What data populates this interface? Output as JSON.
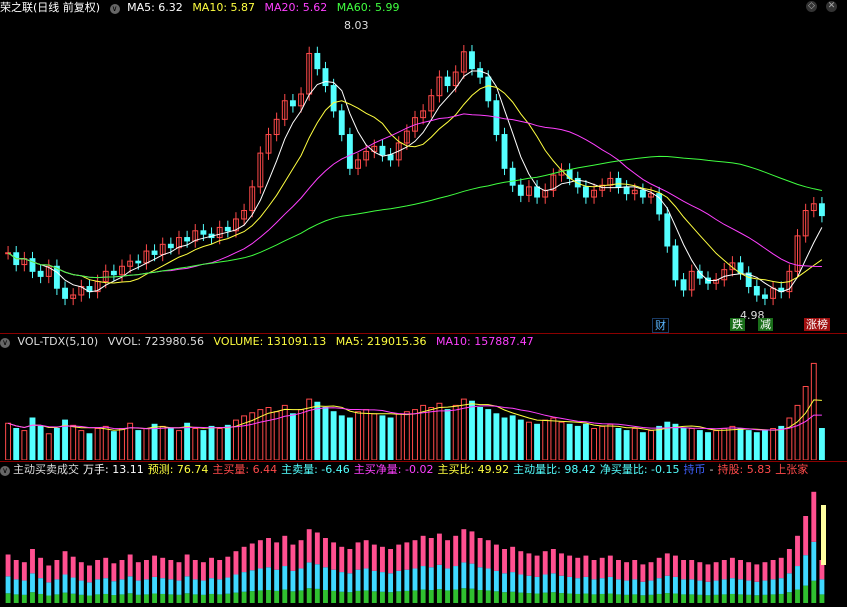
{
  "main_header": {
    "stock_name": "荣之联",
    "period": "(日线 前复权)",
    "ma5": "MA5: 6.32",
    "ma10": "MA10: 5.87",
    "ma20": "MA20: 5.62",
    "ma60": "MA60: 5.99"
  },
  "vol_header": {
    "indicator": "VOL-TDX(5,10)",
    "vvol": "VVOL: 723980.56",
    "volume": "VOLUME: 131091.13",
    "ma5": "MA5: 219015.36",
    "ma10": "MA10: 157887.47"
  },
  "flow_header": {
    "indicator": "主动买卖成交",
    "wanshou": "万手: 13.11",
    "yuce": "预测: 76.74",
    "zhumai": "主买量: 6.44",
    "zhumaichu": "主卖量: -6.46",
    "zhumaijing": "主买净量: -0.02",
    "zhumaibi": "主买比: 49.92",
    "zhudongbi": "主动量比: 98.42",
    "jingmai": "净买量比: -0.15",
    "chibi": "持币",
    "dash": "-",
    "chigu": "持股: 5.83",
    "shangzhang": "上张家"
  },
  "annotations": {
    "high": "8.03",
    "low": "4.98",
    "cai": "财",
    "die": "跌",
    "jian": "减",
    "zhangbang": "涨榜"
  },
  "colors": {
    "up": "#ff4a4a",
    "down": "#54ffff",
    "ma5": "#ffffff",
    "ma10": "#ffff40",
    "ma20": "#ff40ff",
    "ma60": "#40ff40"
  },
  "chart_data": {
    "type": "line",
    "title": "荣之联",
    "high_label": 8.03,
    "low_label": 4.98,
    "ylim": [
      4.7,
      8.3
    ],
    "closes": [
      5.52,
      5.38,
      5.45,
      5.3,
      5.24,
      5.36,
      5.1,
      4.98,
      5.02,
      5.12,
      5.06,
      5.18,
      5.3,
      5.26,
      5.36,
      5.42,
      5.4,
      5.54,
      5.5,
      5.62,
      5.58,
      5.7,
      5.66,
      5.78,
      5.74,
      5.7,
      5.82,
      5.78,
      5.92,
      6.02,
      6.3,
      6.7,
      6.92,
      7.1,
      7.32,
      7.26,
      7.4,
      7.88,
      7.7,
      7.5,
      7.2,
      6.92,
      6.52,
      6.62,
      6.72,
      6.78,
      6.68,
      6.62,
      6.82,
      6.96,
      7.12,
      7.2,
      7.38,
      7.6,
      7.5,
      7.66,
      7.9,
      7.7,
      7.6,
      7.32,
      6.92,
      6.52,
      6.32,
      6.2,
      6.3,
      6.18,
      6.26,
      6.44,
      6.5,
      6.4,
      6.3,
      6.18,
      6.26,
      6.32,
      6.4,
      6.3,
      6.22,
      6.26,
      6.18,
      6.22,
      5.98,
      5.6,
      5.2,
      5.08,
      5.3,
      5.22,
      5.16,
      5.2,
      5.32,
      5.4,
      5.28,
      5.12,
      5.02,
      4.98,
      5.1,
      5.06,
      5.3,
      5.72,
      6.02,
      6.1,
      5.96
    ],
    "volume": [
      0.35,
      0.3,
      0.28,
      0.4,
      0.32,
      0.25,
      0.3,
      0.38,
      0.33,
      0.28,
      0.25,
      0.3,
      0.32,
      0.27,
      0.3,
      0.35,
      0.28,
      0.3,
      0.34,
      0.32,
      0.3,
      0.28,
      0.35,
      0.3,
      0.28,
      0.32,
      0.3,
      0.33,
      0.38,
      0.42,
      0.45,
      0.48,
      0.5,
      0.46,
      0.52,
      0.44,
      0.48,
      0.58,
      0.55,
      0.5,
      0.46,
      0.42,
      0.4,
      0.46,
      0.48,
      0.44,
      0.42,
      0.4,
      0.44,
      0.46,
      0.48,
      0.52,
      0.5,
      0.54,
      0.48,
      0.52,
      0.58,
      0.56,
      0.5,
      0.48,
      0.44,
      0.4,
      0.42,
      0.38,
      0.36,
      0.34,
      0.38,
      0.4,
      0.36,
      0.34,
      0.32,
      0.34,
      0.3,
      0.32,
      0.34,
      0.3,
      0.28,
      0.3,
      0.26,
      0.28,
      0.32,
      0.36,
      0.34,
      0.3,
      0.3,
      0.28,
      0.26,
      0.28,
      0.3,
      0.32,
      0.3,
      0.28,
      0.26,
      0.28,
      0.3,
      0.32,
      0.4,
      0.52,
      0.7,
      0.92,
      0.3
    ]
  }
}
